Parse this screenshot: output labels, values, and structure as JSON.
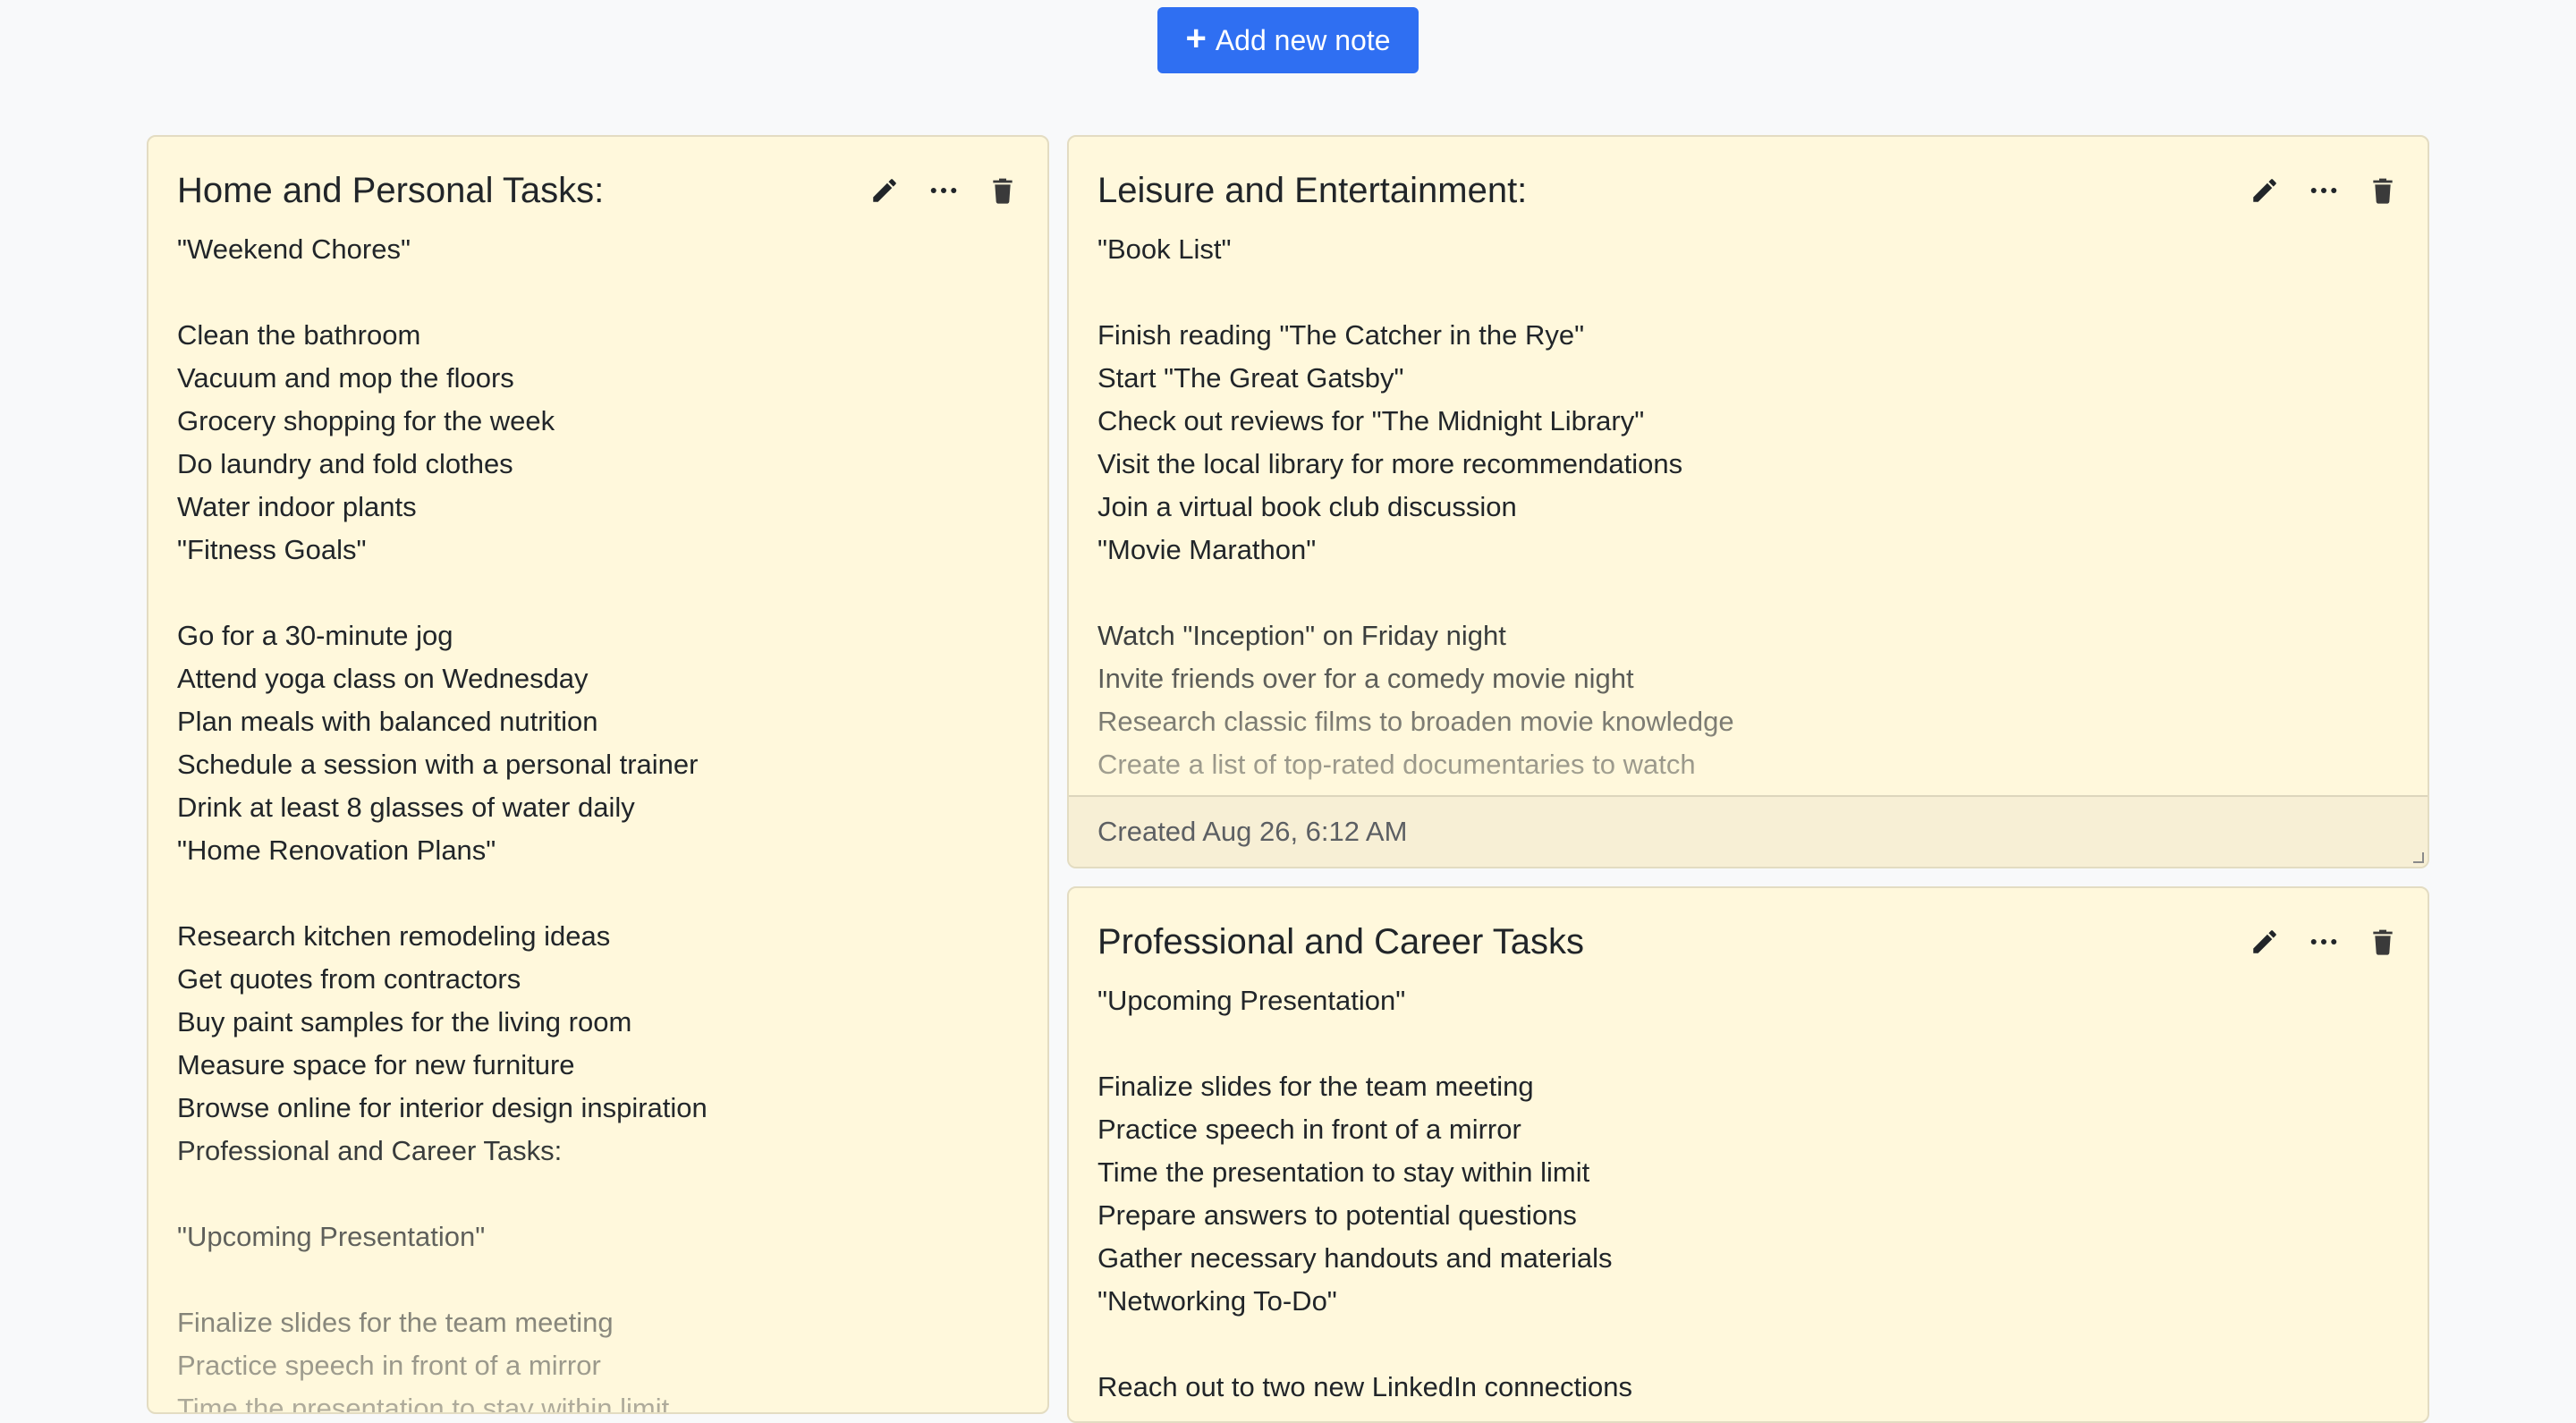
{
  "add_button": {
    "label": "Add new note",
    "icon": "plus-icon"
  },
  "colors": {
    "accent": "#2f6ff2",
    "card_bg": "#fff8dc",
    "page_bg": "#f8f9fa"
  },
  "notes": [
    {
      "title": "Home and Personal Tasks:",
      "lines": [
        "\"Weekend Chores\"",
        "",
        "Clean the bathroom",
        "Vacuum and mop the floors",
        "Grocery shopping for the week",
        "Do laundry and fold clothes",
        "Water indoor plants",
        "\"Fitness Goals\"",
        "",
        "Go for a 30-minute jog",
        "Attend yoga class on Wednesday",
        "Plan meals with balanced nutrition",
        "Schedule a session with a personal trainer",
        "Drink at least 8 glasses of water daily",
        "\"Home Renovation Plans\"",
        "",
        "Research kitchen remodeling ideas",
        "Get quotes from contractors",
        "Buy paint samples for the living room",
        "Measure space for new furniture",
        "Browse online for interior design inspiration",
        "Professional and Career Tasks:",
        "",
        "\"Upcoming Presentation\"",
        "",
        "Finalize slides for the team meeting",
        "Practice speech in front of a mirror",
        "Time the presentation to stay within limit"
      ]
    },
    {
      "title": "Leisure and Entertainment:",
      "lines": [
        "\"Book List\"",
        "",
        "Finish reading \"The Catcher in the Rye\"",
        "Start \"The Great Gatsby\"",
        "Check out reviews for \"The Midnight Library\"",
        "Visit the local library for more recommendations",
        "Join a virtual book club discussion",
        "\"Movie Marathon\"",
        "",
        "Watch \"Inception\" on Friday night",
        "Invite friends over for a comedy movie night",
        "Research classic films to broaden movie knowledge",
        "Create a list of top-rated documentaries to watch"
      ],
      "footer": "Created Aug 26, 6:12 AM"
    },
    {
      "title": "Professional and Career Tasks",
      "lines": [
        "\"Upcoming Presentation\"",
        "",
        "Finalize slides for the team meeting",
        "Practice speech in front of a mirror",
        "Time the presentation to stay within limit",
        "Prepare answers to potential questions",
        "Gather necessary handouts and materials",
        "\"Networking To-Do\"",
        "",
        "Reach out to two new LinkedIn connections"
      ]
    }
  ]
}
